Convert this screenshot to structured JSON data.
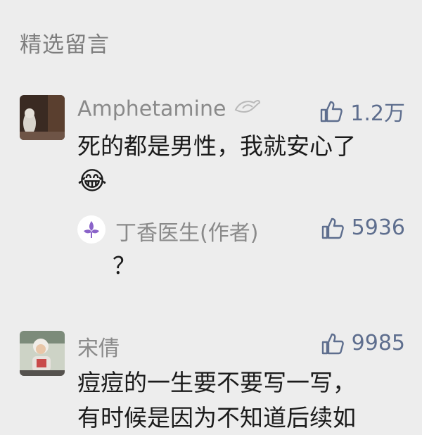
{
  "section": {
    "title": "精选留言"
  },
  "comments": [
    {
      "author": "Amphetamine",
      "likes": "1.2万",
      "text": "死的都是男性，我就安心了",
      "emoji": "😂",
      "reply": {
        "author": "丁香医生(作者)",
        "likes": "5936",
        "text": "？"
      }
    },
    {
      "author": "宋倩",
      "likes": "9985",
      "text_line1": "痘痘的一生要不要写一写，",
      "text_line2": "有时候是因为不知道后续如"
    }
  ]
}
